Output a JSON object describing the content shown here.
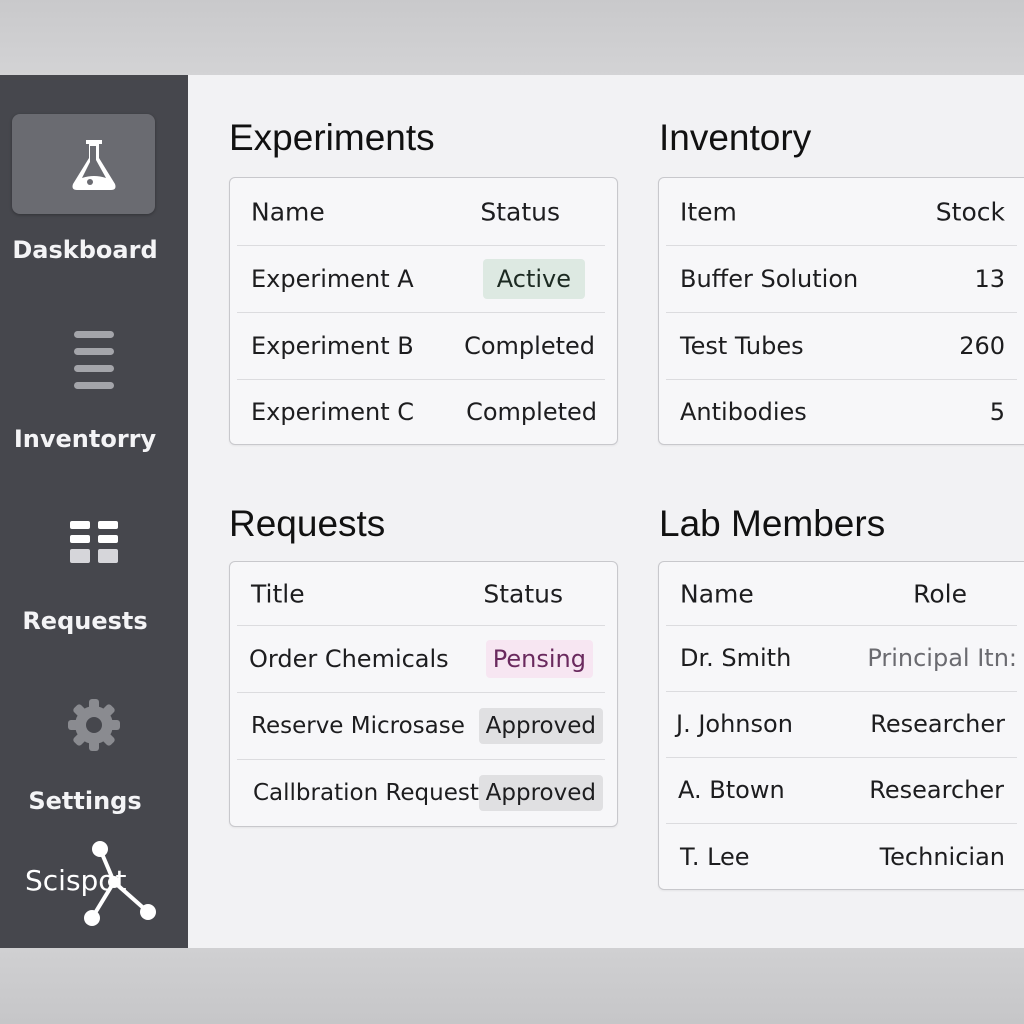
{
  "sidebar": {
    "items": [
      {
        "label": "Daskboard",
        "icon": "flask-icon",
        "active": true
      },
      {
        "label": "Inventorry",
        "icon": "list-icon",
        "active": false
      },
      {
        "label": "Requests",
        "icon": "grid-icon",
        "active": false
      },
      {
        "label": "Settings",
        "icon": "gear-icon",
        "active": false
      }
    ],
    "logo_text": "Scispot"
  },
  "experiments": {
    "title": "Experiments",
    "headers": [
      "Name",
      "Status"
    ],
    "rows": [
      {
        "name": "Experiment A",
        "status": "Active"
      },
      {
        "name": "Experiment B",
        "status": "Completed"
      },
      {
        "name": "Experiment C",
        "status": "Completed"
      }
    ]
  },
  "inventory": {
    "title": "Inventory",
    "headers": [
      "Item",
      "Stock"
    ],
    "rows": [
      {
        "item": "Buffer Solution",
        "stock": "13"
      },
      {
        "item": "Test Tubes",
        "stock": "260"
      },
      {
        "item": "Antibodies",
        "stock": "5"
      }
    ]
  },
  "requests": {
    "title": "Requests",
    "headers": [
      "Title",
      "Status"
    ],
    "rows": [
      {
        "title": "Order Chemicals",
        "status": "Pensing"
      },
      {
        "title": "Reserve Microsase",
        "status": "Approved"
      },
      {
        "title": "Callbration Request",
        "status": "Approved"
      }
    ]
  },
  "lab_members": {
    "title": "Lab Members",
    "headers": [
      "Name",
      "Role"
    ],
    "rows": [
      {
        "name": "Dr. Smith",
        "role": "Principal Itn:"
      },
      {
        "name": "J. Johnson",
        "role": "Researcher"
      },
      {
        "name": "A. Btown",
        "role": "Researcher"
      },
      {
        "name": "T. Lee",
        "role": "Technician"
      }
    ]
  },
  "colors": {
    "sidebar": "#46474d",
    "active_badge": "#dde9e2",
    "pending_badge": "#f7e6f2",
    "approved_badge": "#e0e0e2"
  }
}
